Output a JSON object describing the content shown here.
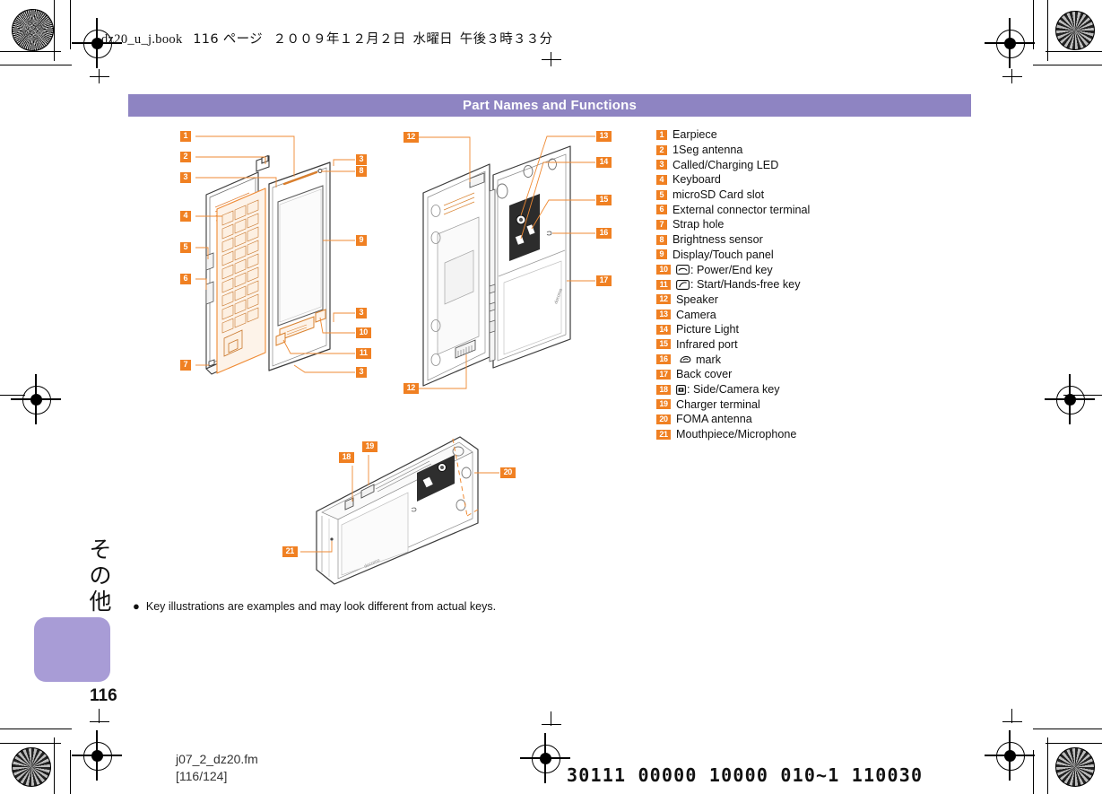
{
  "slug": {
    "file": "dz20_u_j.book",
    "page_label": "116 ページ",
    "date": "２００９年１２月２日",
    "weekday": "水曜日",
    "time": "午後３時３３分"
  },
  "header": {
    "title": "Part Names and Functions",
    "bar_color": "#8e84c2"
  },
  "side_tab": {
    "chars": [
      "そ",
      "の",
      "他"
    ],
    "tab_color": "#a89cd6",
    "page_number": "116"
  },
  "footnote": {
    "bullet": "●",
    "text": "Key illustrations are examples and may look different from actual keys."
  },
  "legend": {
    "badge_color": "#f08022",
    "items": [
      {
        "num": "1",
        "label": "Earpiece",
        "icon": ""
      },
      {
        "num": "2",
        "label": "1Seg antenna",
        "icon": ""
      },
      {
        "num": "3",
        "label": "Called/Charging LED",
        "icon": ""
      },
      {
        "num": "4",
        "label": "Keyboard",
        "icon": ""
      },
      {
        "num": "5",
        "label": "microSD Card slot",
        "icon": ""
      },
      {
        "num": "6",
        "label": "External connector terminal",
        "icon": ""
      },
      {
        "num": "7",
        "label": "Strap hole",
        "icon": ""
      },
      {
        "num": "8",
        "label": "Brightness sensor",
        "icon": ""
      },
      {
        "num": "9",
        "label": "Display/Touch panel",
        "icon": ""
      },
      {
        "num": "10",
        "label": ": Power/End key",
        "icon": "end-key-icon"
      },
      {
        "num": "11",
        "label": ": Start/Hands-free key",
        "icon": "start-key-icon"
      },
      {
        "num": "12",
        "label": "Speaker",
        "icon": ""
      },
      {
        "num": "13",
        "label": "Camera",
        "icon": ""
      },
      {
        "num": "14",
        "label": "Picture Light",
        "icon": ""
      },
      {
        "num": "15",
        "label": "Infrared port",
        "icon": ""
      },
      {
        "num": "16",
        "label": " mark",
        "icon": "felica-mark-icon"
      },
      {
        "num": "17",
        "label": "Back cover",
        "icon": ""
      },
      {
        "num": "18",
        "label": ": Side/Camera key",
        "icon": "side-camera-key-icon"
      },
      {
        "num": "19",
        "label": "Charger terminal",
        "icon": ""
      },
      {
        "num": "20",
        "label": "FOMA antenna",
        "icon": ""
      },
      {
        "num": "21",
        "label": "Mouthpiece/Microphone",
        "icon": ""
      }
    ]
  },
  "figures": {
    "fig1": {
      "name": "front-and-keyboard-view",
      "callouts": [
        "1",
        "2",
        "3",
        "4",
        "5",
        "6",
        "7",
        "3",
        "8",
        "9",
        "3",
        "10",
        "11",
        "3"
      ]
    },
    "fig2": {
      "name": "rear-and-back-cover-view",
      "callouts": [
        "12",
        "12",
        "13",
        "14",
        "15",
        "16",
        "17"
      ]
    },
    "fig3": {
      "name": "landscape-rear-view",
      "callouts": [
        "18",
        "19",
        "20",
        "21"
      ]
    }
  },
  "footer": {
    "filename": "j07_2_dz20.fm",
    "page_range": "[116/124]",
    "code": "30111 00000 10000 010~1 110030"
  }
}
